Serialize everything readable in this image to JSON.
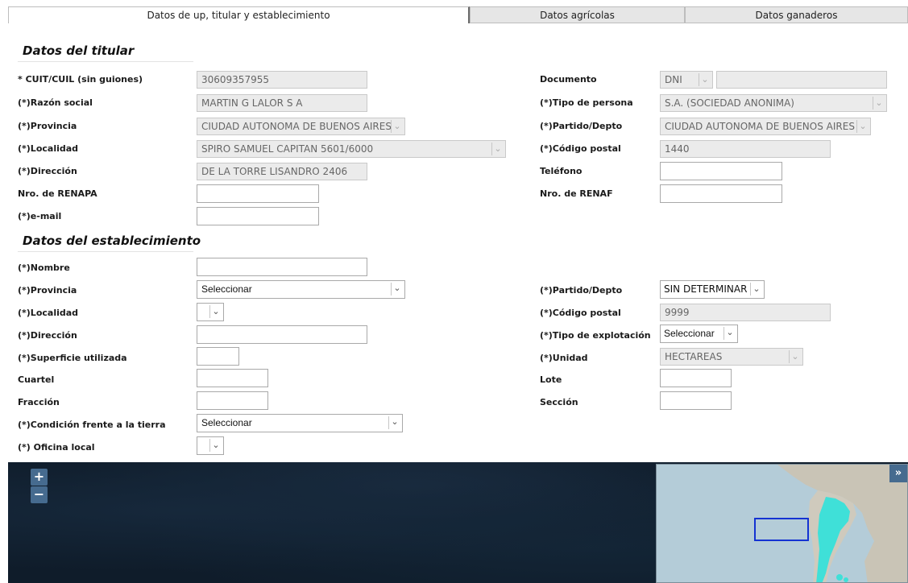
{
  "tabs": [
    {
      "label": "Datos de up, titular y establecimiento"
    },
    {
      "label": "Datos agrícolas"
    },
    {
      "label": "Datos ganaderos"
    }
  ],
  "titular": {
    "title": "Datos del titular",
    "cuit_label": "* CUIT/CUIL (sin guiones)",
    "cuit_value": "30609357955",
    "documento_label": "Documento",
    "documento_type": "DNI",
    "documento_value": "",
    "razon_label": "(*)Razón social",
    "razon_value": "MARTIN G LALOR S A",
    "tipo_persona_label": "(*)Tipo de persona",
    "tipo_persona_value": "S.A. (SOCIEDAD ANONIMA)",
    "provincia_label": "(*)Provincia",
    "provincia_value": "CIUDAD AUTONOMA DE BUENOS AIRES",
    "partido_label": "(*)Partido/Depto",
    "partido_value": "CIUDAD AUTONOMA DE BUENOS AIRES",
    "localidad_label": "(*)Localidad",
    "localidad_value": "SPIRO SAMUEL CAPITAN 5601/6000",
    "cp_label": "(*)Código postal",
    "cp_value": "1440",
    "direccion_label": "(*)Dirección",
    "direccion_value": "DE LA TORRE LISANDRO 2406",
    "telefono_label": "Teléfono",
    "telefono_value": "",
    "renapa_label": "Nro. de RENAPA",
    "renapa_value": "",
    "renaf_label": "Nro. de RENAF",
    "renaf_value": "",
    "email_label": "(*)e-mail",
    "email_value": ""
  },
  "establecimiento": {
    "title": "Datos del establecimiento",
    "nombre_label": "(*)Nombre",
    "nombre_value": "",
    "provincia_label": "(*)Provincia",
    "provincia_value": "Seleccionar",
    "partido_label": "(*)Partido/Depto",
    "partido_value": "SIN DETERMINAR",
    "localidad_label": "(*)Localidad",
    "localidad_value": "",
    "cp_label": "(*)Código postal",
    "cp_value": "9999",
    "direccion_label": "(*)Dirección",
    "direccion_value": "",
    "tipo_explotacion_label": "(*)Tipo de explotación",
    "tipo_explotacion_value": "Seleccionar",
    "superficie_label": "(*)Superficie utilizada",
    "superficie_value": "",
    "unidad_label": "(*)Unidad",
    "unidad_value": "HECTAREAS",
    "cuartel_label": "Cuartel",
    "cuartel_value": "",
    "lote_label": "Lote",
    "lote_value": "",
    "fraccion_label": "Fracción",
    "fraccion_value": "",
    "seccion_label": "Sección",
    "seccion_value": "",
    "condicion_label": "(*)Condición frente a la tierra",
    "condicion_value": "Seleccionar",
    "oficina_label": "(*) Oficina local",
    "oficina_value": ""
  },
  "map": {
    "zoom_in": "+",
    "zoom_out": "−",
    "overview_toggle": "»",
    "land_color": "#3fe0d8",
    "water_color": "#b4ccd8",
    "extent_color": "#1432d2"
  }
}
